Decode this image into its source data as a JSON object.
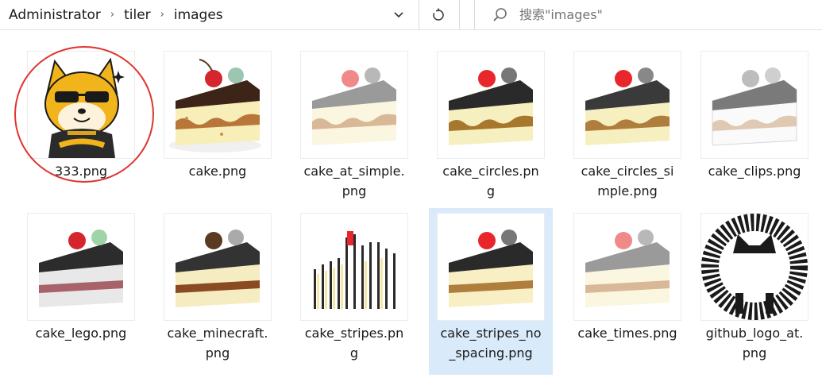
{
  "address": {
    "crumbs": [
      "Administrator",
      "tiler",
      "images"
    ]
  },
  "search": {
    "placeholder": "搜索\"images\""
  },
  "files": [
    {
      "name": "333.png",
      "line1": "333.png",
      "line2": ""
    },
    {
      "name": "cake.png",
      "line1": "cake.png",
      "line2": ""
    },
    {
      "name": "cake_at_simple.png",
      "line1": "cake_at_simple.",
      "line2": "png"
    },
    {
      "name": "cake_circles.png",
      "line1": "cake_circles.pn",
      "line2": "g"
    },
    {
      "name": "cake_circles_simple.png",
      "line1": "cake_circles_si",
      "line2": "mple.png"
    },
    {
      "name": "cake_clips.png",
      "line1": "cake_clips.png",
      "line2": ""
    },
    {
      "name": "cake_lego.png",
      "line1": "cake_lego.png",
      "line2": ""
    },
    {
      "name": "cake_minecraft.png",
      "line1": "cake_minecraft.",
      "line2": "png"
    },
    {
      "name": "cake_stripes.png",
      "line1": "cake_stripes.pn",
      "line2": "g"
    },
    {
      "name": "cake_stripes_no_spacing.png",
      "line1": "cake_stripes_no",
      "line2": "_spacing.png"
    },
    {
      "name": "cake_times.png",
      "line1": "cake_times.png",
      "line2": ""
    },
    {
      "name": "github_logo_at.png",
      "line1": "github_logo_at.",
      "line2": "png"
    }
  ],
  "selected_file": "cake_stripes_no_spacing.png",
  "colors": {
    "selection": "#d9ebfa",
    "annotation_ring": "#e0342f"
  }
}
